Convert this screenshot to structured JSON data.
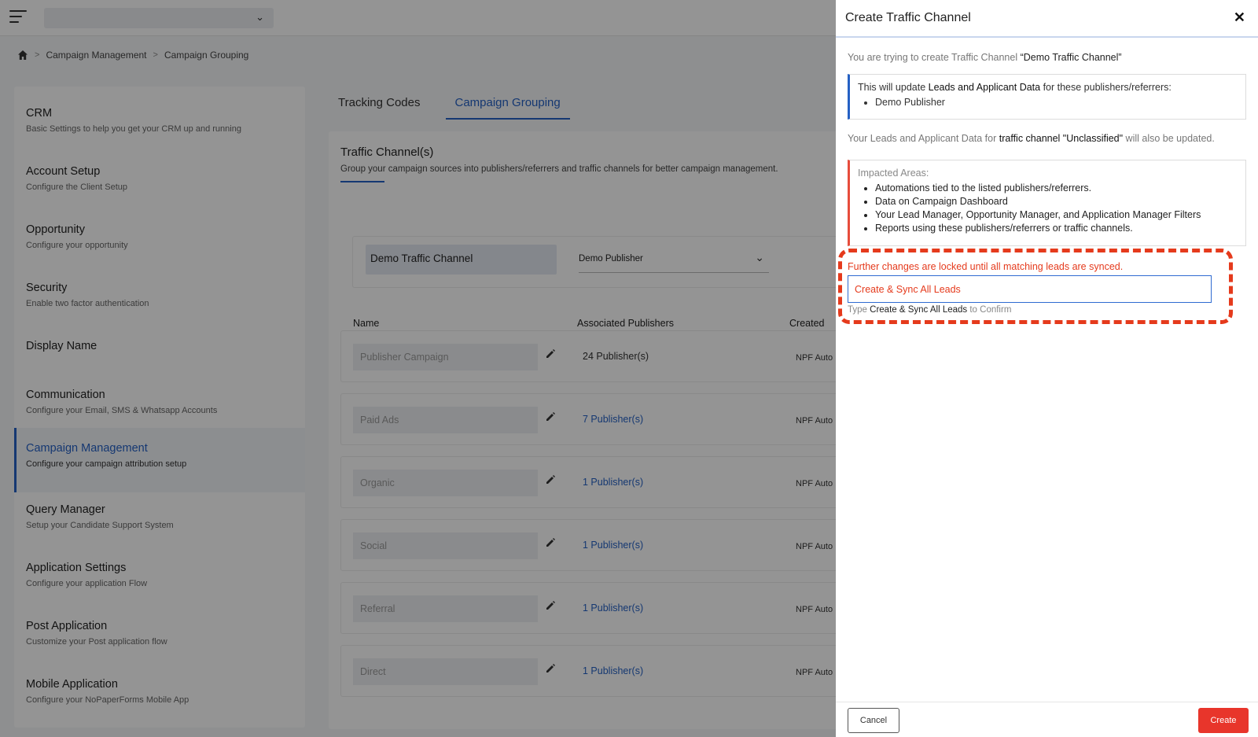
{
  "breadcrumb": {
    "items": [
      "Campaign Management",
      "Campaign Grouping"
    ],
    "separator": ">"
  },
  "sidebar": {
    "items": [
      {
        "label": "CRM",
        "sub": "Basic Settings to help you get your CRM up and running"
      },
      {
        "label": "Account Setup",
        "sub": "Configure the Client Setup"
      },
      {
        "label": "Opportunity",
        "sub": "Configure your opportunity"
      },
      {
        "label": "Security",
        "sub": "Enable two factor authentication"
      },
      {
        "label": "Display Name",
        "sub": ""
      },
      {
        "label": "Communication",
        "sub": "Configure your Email, SMS & Whatsapp Accounts"
      },
      {
        "label": "Campaign Management",
        "sub": "Configure your campaign attribution setup",
        "active": true
      },
      {
        "label": "Query Manager",
        "sub": "Setup your Candidate Support System"
      },
      {
        "label": "Application Settings",
        "sub": "Configure your application Flow"
      },
      {
        "label": "Post Application",
        "sub": "Customize your Post application flow"
      },
      {
        "label": "Mobile Application",
        "sub": "Configure your NoPaperForms Mobile App"
      }
    ]
  },
  "tabs": [
    "Tracking Codes",
    "Campaign Grouping"
  ],
  "active_tab": "Campaign Grouping",
  "card": {
    "title": "Traffic Channel(s)",
    "subtitle": "Group your campaign sources into publishers/referrers and traffic channels for better campaign management.",
    "new_channel_value": "Demo Traffic Channel",
    "publisher_select_value": "Demo Publisher",
    "columns": [
      "Name",
      "Associated Publishers",
      "Created"
    ],
    "rows": [
      {
        "name": "Publisher Campaign",
        "publishers": "24 Publisher(s)",
        "created_by": "NPF Auto"
      },
      {
        "name": "Paid Ads",
        "publishers": "7 Publisher(s)",
        "created_by": "NPF Auto"
      },
      {
        "name": "Organic",
        "publishers": "1 Publisher(s)",
        "created_by": "NPF Auto"
      },
      {
        "name": "Social",
        "publishers": "1 Publisher(s)",
        "created_by": "NPF Auto"
      },
      {
        "name": "Referral",
        "publishers": "1 Publisher(s)",
        "created_by": "NPF Auto"
      },
      {
        "name": "Direct",
        "publishers": "1 Publisher(s)",
        "created_by": "NPF Auto"
      }
    ]
  },
  "drawer": {
    "title": "Create Traffic Channel",
    "close": "✕",
    "intro_prefix": "You are trying to create Traffic Channel ",
    "intro_name": "“Demo Traffic Channel”",
    "info_prefix": "This will update ",
    "info_bold": "Leads and Applicant Data",
    "info_suffix": " for these publishers/referrers:",
    "info_items": [
      "Demo Publisher"
    ],
    "also_prefix": "Your Leads and Applicant Data for ",
    "also_bold": "traffic channel \"Unclassified\"",
    "also_suffix": " will also be updated.",
    "impacted_title": "Impacted Areas:",
    "impacted_items": [
      "Automations tied to the listed publishers/referrers.",
      "Data on Campaign Dashboard",
      "Your Lead Manager, Opportunity Manager, and Application Manager Filters",
      "Reports using these publishers/referrers or traffic channels."
    ],
    "lock_message": "Further changes are locked until all matching leads are synced.",
    "confirm_value": "Create & Sync All Leads",
    "hint_prefix": "Type ",
    "hint_bold": "Create & Sync All Leads",
    "hint_suffix": " to Confirm",
    "cancel_label": "Cancel",
    "create_label": "Create"
  },
  "colors": {
    "accent": "#2561c4",
    "danger": "#e53a1c",
    "create_button": "#e8352b"
  },
  "icons": [
    "menu-icon",
    "chevron-down-icon",
    "home-icon",
    "pencil-icon",
    "close-icon"
  ]
}
